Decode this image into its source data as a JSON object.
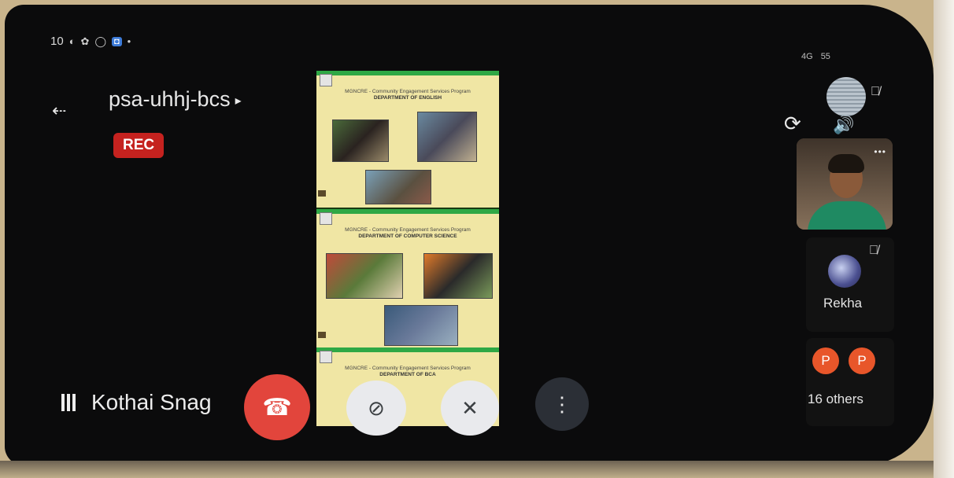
{
  "status_bar": {
    "time": "10",
    "icons": [
      "screen-record-icon",
      "settings-icon",
      "whatsapp-icon",
      "app-icon",
      "dot-icon"
    ],
    "app_badge": "◘",
    "network": "4G",
    "battery": "55"
  },
  "meeting": {
    "code": "psa-uhhj-bcs",
    "recording_badge": "REC"
  },
  "presenter": {
    "name": "Kothai Snag"
  },
  "slides": [
    {
      "heading": "MGNCRE - Community Engagement Services Program",
      "department": "DEPARTMENT OF ENGLISH"
    },
    {
      "heading": "MGNCRE - Community Engagement Services Program",
      "department": "DEPARTMENT OF COMPUTER SCIENCE"
    },
    {
      "heading": "MGNCRE - Community Engagement Services Program",
      "department": "DEPARTMENT OF BCA"
    }
  ],
  "participants": {
    "rekha": "Rekha",
    "others_count_label": "16 others",
    "others_initials": [
      "P",
      "P"
    ]
  },
  "controls": {
    "end_call_icon": "☎",
    "camera_off_icon": "⊘",
    "mic_off_icon": "✕",
    "more_icon": "⋮"
  },
  "colors": {
    "rec_red": "#c5221f",
    "end_call_red": "#e2453c",
    "avatar_orange": "#e8562a",
    "slide_green": "#2fa845"
  }
}
